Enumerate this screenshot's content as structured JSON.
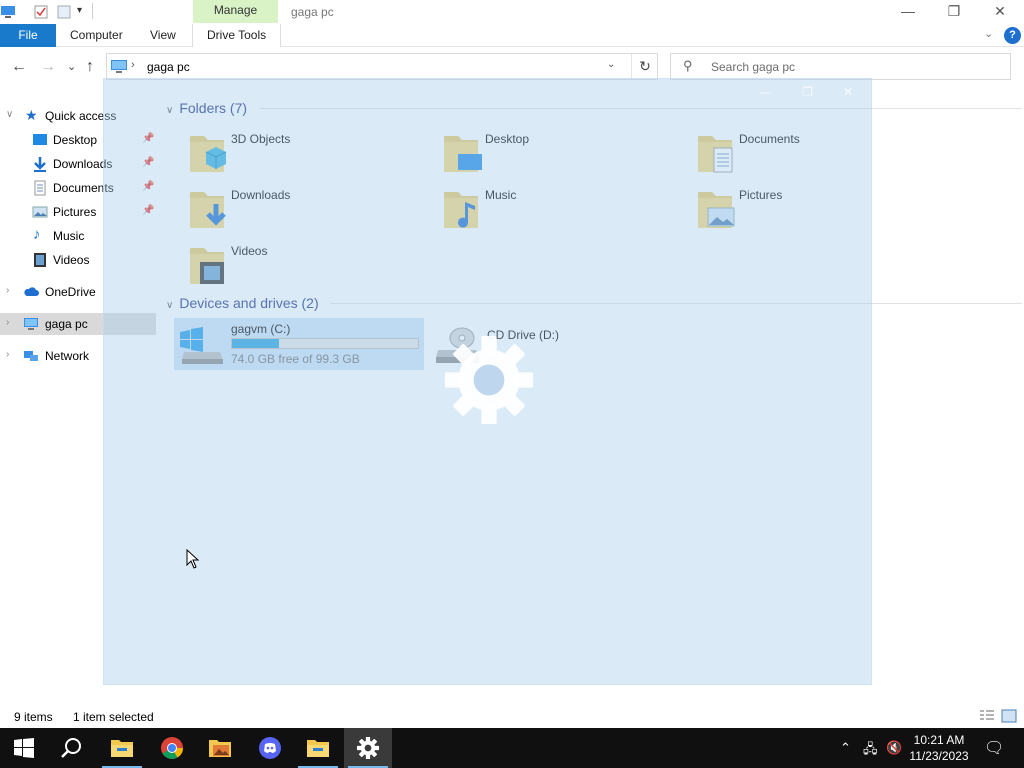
{
  "window": {
    "title": "gaga pc",
    "context_tab": "Manage",
    "minimize": "—",
    "restore": "❐",
    "close": "✕"
  },
  "ribbon": {
    "tabs": [
      "File",
      "Computer",
      "View",
      "Drive Tools"
    ],
    "help": "?",
    "collapse": "⌄"
  },
  "address": {
    "path": "gaga pc",
    "search_placeholder": "Search gaga pc",
    "back": "←",
    "forward": "→",
    "recent": "⌄",
    "up": "↑",
    "refresh": "↻",
    "chevron": "›",
    "dropdown": "⌄"
  },
  "navpane": {
    "quick_access": "Quick access",
    "items": [
      {
        "label": "Desktop",
        "icon": "desktop-icon",
        "pinned": true
      },
      {
        "label": "Downloads",
        "icon": "downloads-icon",
        "pinned": true
      },
      {
        "label": "Documents",
        "icon": "documents-icon",
        "pinned": true
      },
      {
        "label": "Pictures",
        "icon": "pictures-icon",
        "pinned": true
      },
      {
        "label": "Music",
        "icon": "music-icon",
        "pinned": false
      },
      {
        "label": "Videos",
        "icon": "videos-icon",
        "pinned": false
      }
    ],
    "onedrive": "OneDrive",
    "this_pc": "gaga pc",
    "network": "Network"
  },
  "content": {
    "folders_header": "Folders (7)",
    "folders": [
      {
        "name": "3D Objects",
        "icon": "3d-objects-icon"
      },
      {
        "name": "Desktop",
        "icon": "desktop-folder-icon"
      },
      {
        "name": "Documents",
        "icon": "documents-folder-icon"
      },
      {
        "name": "Downloads",
        "icon": "downloads-folder-icon"
      },
      {
        "name": "Music",
        "icon": "music-folder-icon"
      },
      {
        "name": "Pictures",
        "icon": "pictures-folder-icon"
      },
      {
        "name": "Videos",
        "icon": "videos-folder-icon"
      }
    ],
    "drives_header": "Devices and drives (2)",
    "drives": [
      {
        "name": "gagvm (C:)",
        "free_text": "74.0 GB free of 99.3 GB",
        "used_fraction": 0.255,
        "selected": true
      },
      {
        "name": "CD Drive (D:)",
        "selected": false
      }
    ]
  },
  "status": {
    "items": "9 items",
    "selected": "1 item selected"
  },
  "taskbar": {
    "apps": [
      "start-icon",
      "search-icon",
      "file-explorer-icon",
      "chrome-icon",
      "photos-icon",
      "discord-icon",
      "file-explorer-icon",
      "settings-icon"
    ],
    "time": "10:21 AM",
    "date": "11/23/2023"
  },
  "colors": {
    "accent": "#1979ca",
    "selection": "#cce4f7",
    "drive_bar": "#26a0da",
    "folder": "#e8c96a",
    "taskbar": "#101010"
  }
}
